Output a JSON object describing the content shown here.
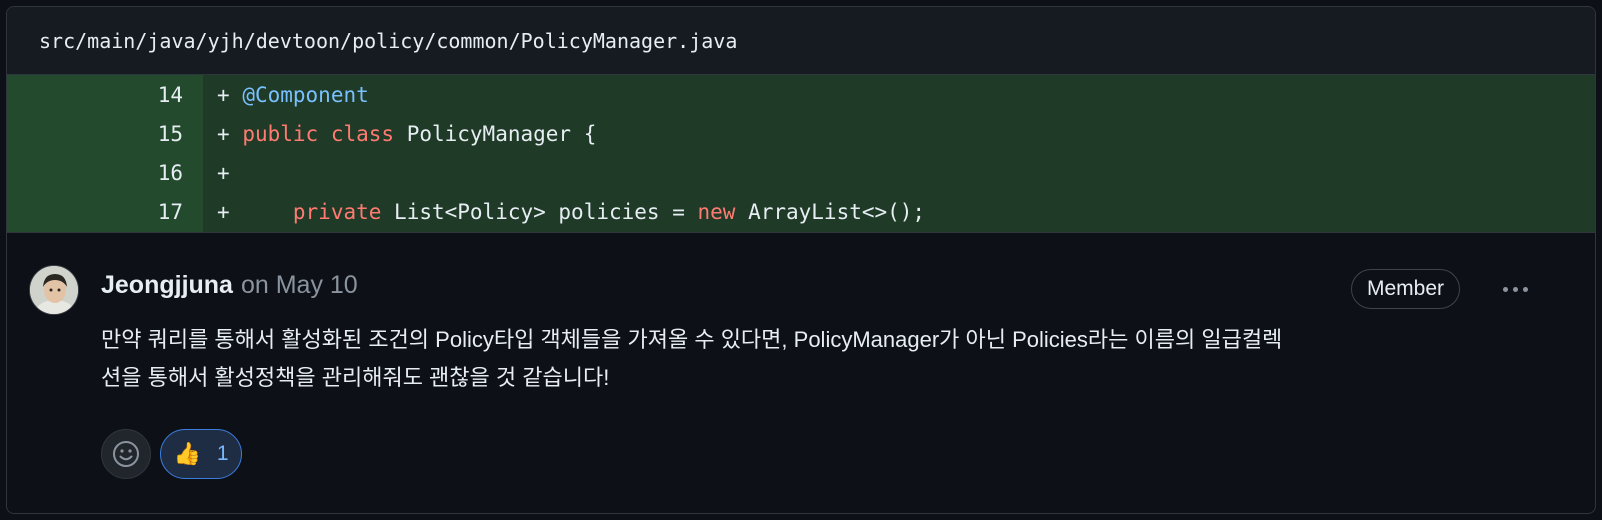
{
  "file": {
    "path": "src/main/java/yjh/devtoon/policy/common/PolicyManager.java"
  },
  "diff": {
    "lines": [
      {
        "number": "14",
        "sign": "+",
        "tokens": [
          {
            "t": "ann",
            "v": "@Component"
          }
        ]
      },
      {
        "number": "15",
        "sign": "+",
        "tokens": [
          {
            "t": "kw",
            "v": "public"
          },
          {
            "t": "plain",
            "v": " "
          },
          {
            "t": "kw",
            "v": "class"
          },
          {
            "t": "plain",
            "v": " PolicyManager {"
          }
        ]
      },
      {
        "number": "16",
        "sign": "+",
        "tokens": []
      },
      {
        "number": "17",
        "sign": "+",
        "tokens": [
          {
            "t": "plain",
            "v": "    "
          },
          {
            "t": "kw",
            "v": "private"
          },
          {
            "t": "plain",
            "v": " List<Policy> policies = "
          },
          {
            "t": "kw",
            "v": "new"
          },
          {
            "t": "plain",
            "v": " ArrayList<>();"
          }
        ]
      }
    ]
  },
  "comment": {
    "author": "Jeongjjuna",
    "date": "on May 10",
    "role_badge": "Member",
    "body_line1": "만약 쿼리를 통해서 활성화된 조건의 Policy타입 객체들을 가져올 수 있다면, PolicyManager가 아닌 Policies라는 이름의 일급컬렉",
    "body_line2": "션을 통해서 활성정책을 관리해줘도 괜찮을 것 같습니다!",
    "reactions": [
      {
        "icon": "thumbs-up-icon",
        "emoji": "👍",
        "count": "1"
      }
    ],
    "add_reaction_icon": "smiley-icon"
  },
  "colors": {
    "background": "#0d1117",
    "diff_added_bg": "#1f3a26",
    "keyword": "#ff7b72",
    "annotation": "#79c0ff",
    "reaction_accent": "#3b7ddd"
  }
}
